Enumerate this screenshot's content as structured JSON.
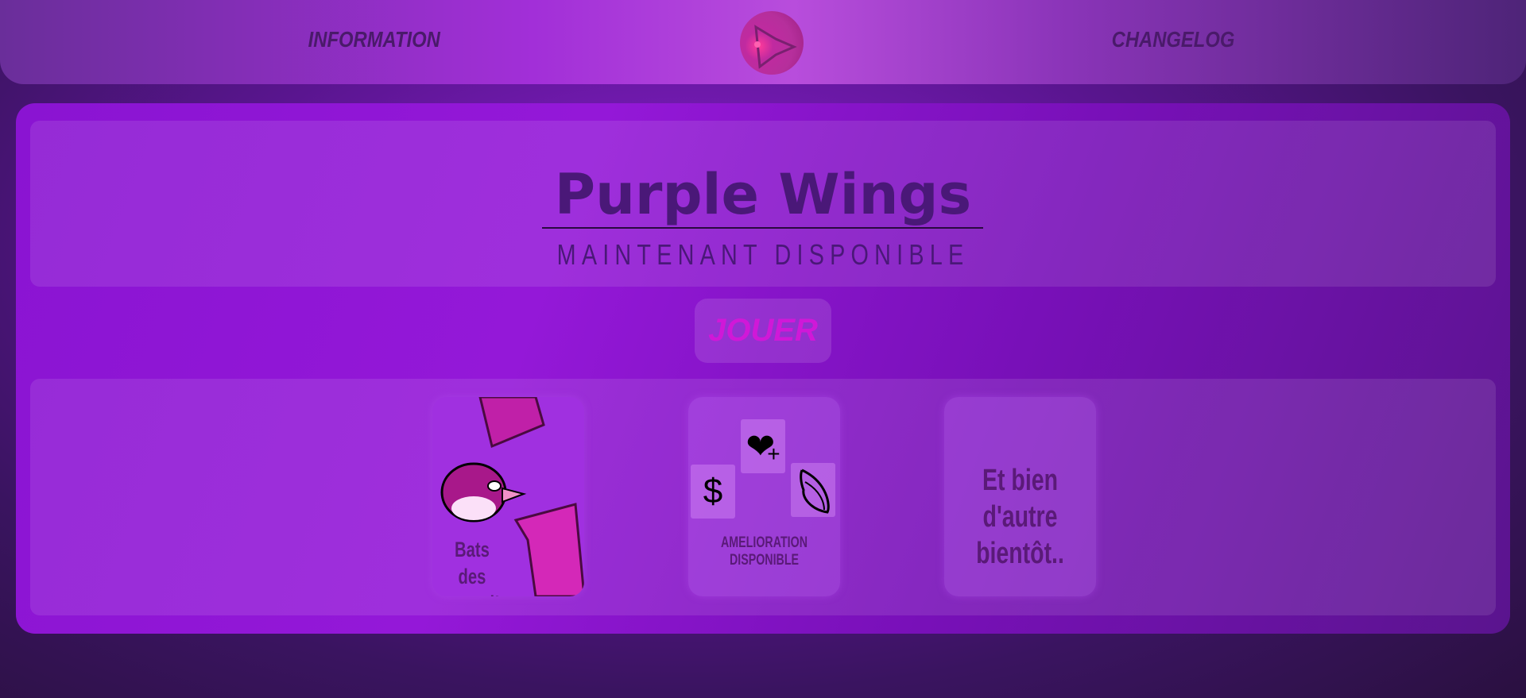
{
  "header": {
    "nav_left": "INFORMATION",
    "nav_right": "CHANGELOG"
  },
  "hero": {
    "title": "Purple Wings",
    "subtitle": "MAINTENANT DISPONIBLE"
  },
  "play_button": "JOUER",
  "cards": [
    {
      "text": "Bats des record!"
    },
    {
      "text": "AMELIORATION DISPONIBLE",
      "icons": [
        "heart-plus-icon",
        "dollar-icon",
        "wing-icon"
      ],
      "dollar": "$"
    },
    {
      "text": "Et bien d'autre bientôt.."
    }
  ],
  "colors": {
    "accent": "#d018d8",
    "text": "#4a1878"
  }
}
